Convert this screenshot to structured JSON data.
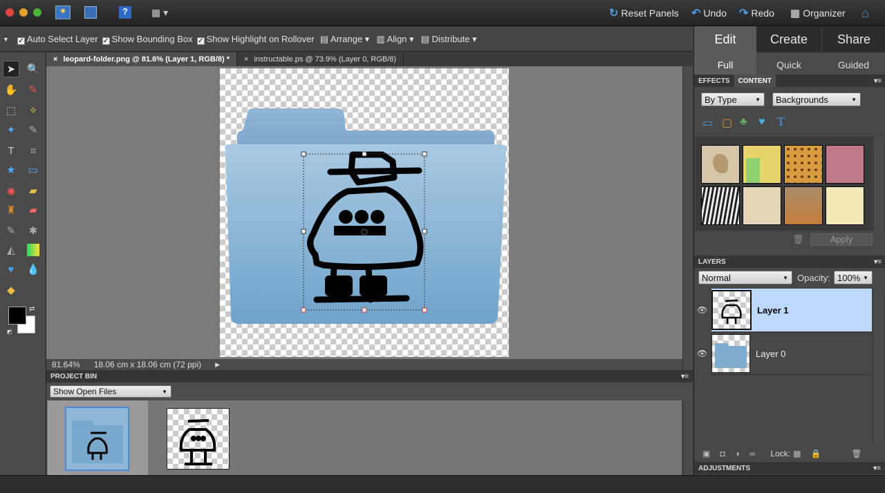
{
  "topbar": {
    "reset_panels": "Reset Panels",
    "undo": "Undo",
    "redo": "Redo",
    "organizer": "Organizer"
  },
  "options": {
    "auto_select": "Auto Select Layer",
    "bounding_box": "Show Bounding Box",
    "highlight": "Show Highlight on Rollover",
    "arrange": "Arrange",
    "align": "Align",
    "distribute": "Distribute"
  },
  "doc_tabs": [
    {
      "label": "leopard-folder.png @ 81.6% (Layer 1, RGB/8) *"
    },
    {
      "label": "instructable.ps @ 73.9% (Layer 0, RGB/8)"
    }
  ],
  "status": {
    "zoom": "81.64%",
    "doc_size": "18.06 cm x 18.06 cm (72 ppi)"
  },
  "project_bin": {
    "title": "PROJECT BIN",
    "dropdown": "Show Open Files"
  },
  "modes": {
    "edit": "Edit",
    "create": "Create",
    "share": "Share",
    "full": "Full",
    "quick": "Quick",
    "guided": "Guided"
  },
  "content_panel": {
    "effects_tab": "EFFECTS",
    "content_tab": "CONTENT",
    "by_type": "By Type",
    "backgrounds": "Backgrounds",
    "apply": "Apply"
  },
  "layers_panel": {
    "title": "LAYERS",
    "blend_mode": "Normal",
    "opacity_label": "Opacity:",
    "opacity_value": "100%",
    "lock_label": "Lock:",
    "layers": [
      {
        "name": "Layer 1"
      },
      {
        "name": "Layer 0"
      }
    ]
  },
  "adjustments": {
    "title": "ADJUSTMENTS"
  },
  "colors": {
    "accent": "#4a9be0",
    "selected_layer": "#bcd8fb",
    "folder_blue": "#8db8d8"
  }
}
